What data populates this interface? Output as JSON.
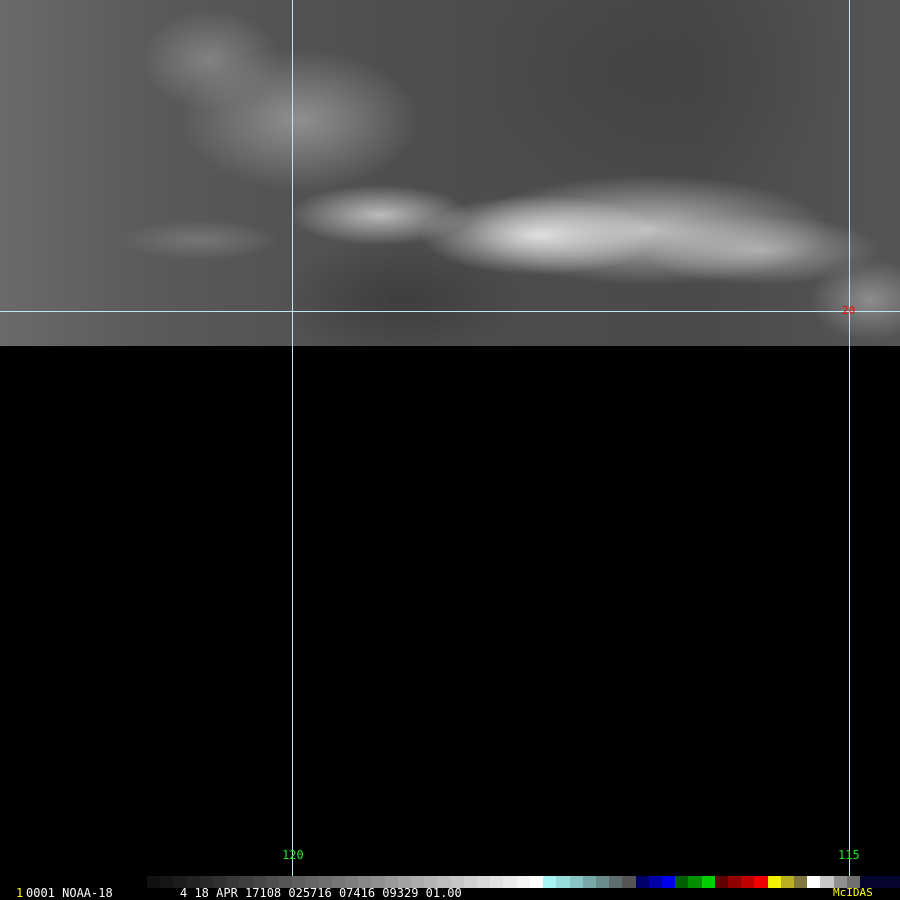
{
  "frame_number": "1",
  "header_text": "0001 NOAA-18",
  "info_text": "4 18 APR 17108 025716 07416 09329 01.00",
  "grid_labels": {
    "lon_120": "120",
    "lon_115": "115",
    "lat_20": "20"
  },
  "brand": "McIDAS",
  "colors": {
    "grid": "#bfe9ee",
    "lon_label": "#22e022",
    "lat_label": "#ff0000",
    "brand": "#ffff00"
  },
  "colorbar": [
    "#111",
    "#161616",
    "#1c1c1c",
    "#222",
    "#292929",
    "#303030",
    "#373737",
    "#3e3e3e",
    "#464646",
    "#4e4e4e",
    "#565656",
    "#5e5e5e",
    "#666",
    "#6e6e6e",
    "#767676",
    "#7e7e7e",
    "#878787",
    "#909090",
    "#999",
    "#a2a2a2",
    "#ababab",
    "#b4b4b4",
    "#bdbdbd",
    "#c6c6c6",
    "#cfcfcf",
    "#d8d8d8",
    "#e1e1e1",
    "#eaeaea",
    "#f3f3f3",
    "#fff",
    "#a8f4f4",
    "#98dcdc",
    "#88c4c4",
    "#78a8a8",
    "#6a8c8c",
    "#5e6e6e",
    "#555",
    "#00006a",
    "#0000a8",
    "#0000f0",
    "#006000",
    "#009000",
    "#00d000",
    "#600000",
    "#900000",
    "#c00000",
    "#f00000",
    "#f0f000",
    "#b8b020",
    "#807840",
    "#fff",
    "#c8c8c8",
    "#909090",
    "#707070",
    "#050530",
    "#050530",
    "#050530"
  ]
}
